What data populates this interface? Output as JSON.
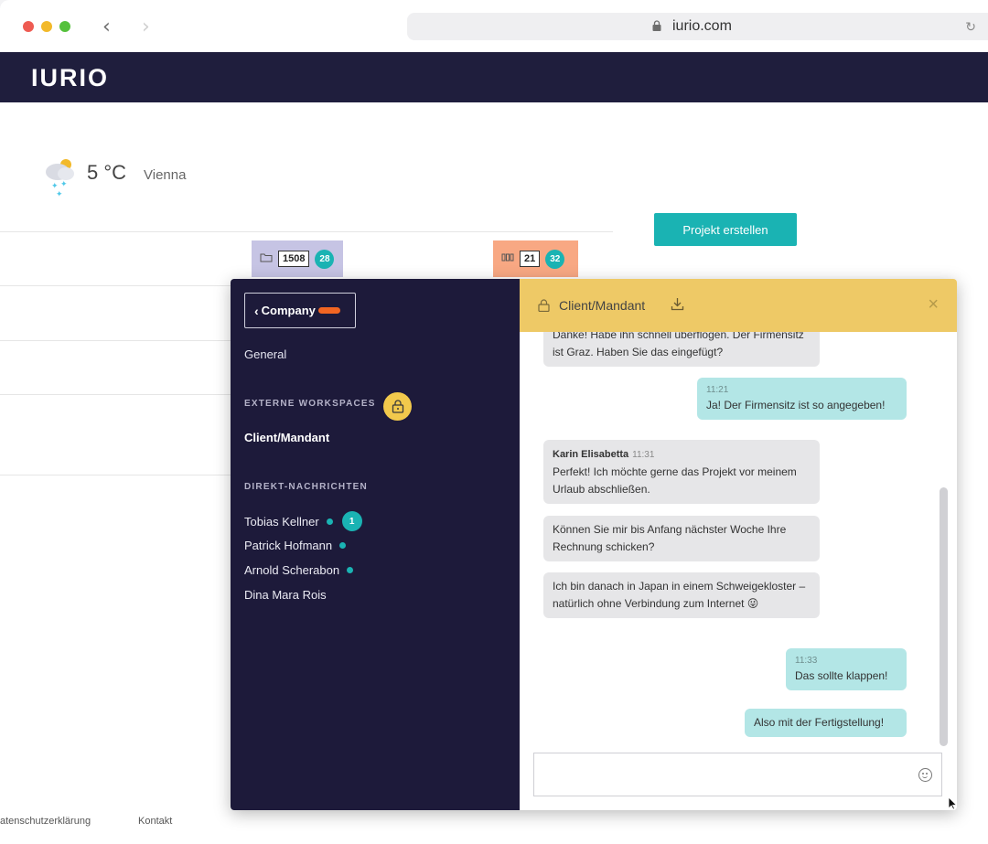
{
  "browser": {
    "url": "iurio.com"
  },
  "app": {
    "logo": "IURIO"
  },
  "weather": {
    "temperature": "5 °C",
    "city": "Vienna"
  },
  "toolbar": {
    "create_project_label": "Projekt erstellen"
  },
  "counters": {
    "documents": {
      "count": "1508",
      "badge": "28"
    },
    "tasks": {
      "count": "21",
      "badge": "32"
    }
  },
  "footer": {
    "privacy": "atenschutzerklärung",
    "contact": "Kontakt"
  },
  "chat": {
    "sidebar": {
      "company_label": "Company",
      "general": "General",
      "external_heading": "EXTERNE WORKSPACES",
      "client_workspace": "Client/Mandant",
      "dm_heading": "DIREKT-NACHRICHTEN",
      "contacts": [
        {
          "name": "Tobias Kellner",
          "unread": "1"
        },
        {
          "name": "Patrick Hofmann"
        },
        {
          "name": "Arnold Scherabon"
        },
        {
          "name": "Dina Mara Rois"
        }
      ]
    },
    "header": {
      "title": "Client/Mandant"
    },
    "messages": [
      {
        "text": "Danke! Habe ihn schnell überflogen. Der Firmensitz ist Graz. Haben Sie das eingefügt?"
      },
      {
        "time": "11:21",
        "text": "Ja! Der Firmensitz ist so angegeben!"
      },
      {
        "sender": "Karin Elisabetta",
        "time": "11:31",
        "text": "Perfekt! Ich möchte gerne das Projekt vor meinem Urlaub abschließen."
      },
      {
        "text": "Können Sie mir bis Anfang nächster Woche Ihre Rechnung schicken?"
      },
      {
        "text": "Ich bin danach in Japan in einem Schweigekloster – natürlich ohne Verbindung zum Internet 😜"
      },
      {
        "time": "11:33",
        "text": "Das sollte klappen!"
      },
      {
        "text": "Also mit der Fertigstellung!"
      }
    ],
    "composer": {
      "value": "",
      "placeholder": ""
    }
  },
  "colors": {
    "navy": "#1f1e3d",
    "teal": "#1ab3b3",
    "header_yellow": "#eec966",
    "orange": "#f26522"
  }
}
